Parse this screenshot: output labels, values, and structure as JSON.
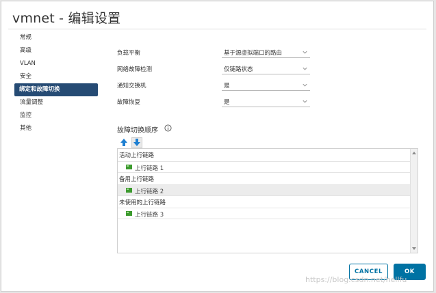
{
  "dialog": {
    "title": "vmnet - 编辑设置"
  },
  "sidebar": {
    "items": [
      {
        "label": "常规"
      },
      {
        "label": "高级"
      },
      {
        "label": "VLAN"
      },
      {
        "label": "安全"
      },
      {
        "label": "绑定和故障切换",
        "active": true
      },
      {
        "label": "流量调整"
      },
      {
        "label": "监控"
      },
      {
        "label": "其他"
      }
    ]
  },
  "settings": {
    "load_balancing": {
      "label": "负载平衡",
      "value": "基于源虚拟端口的路由"
    },
    "network_failure_detection": {
      "label": "网络故障检测",
      "value": "仅链路状态"
    },
    "notify_switches": {
      "label": "通知交换机",
      "value": "是"
    },
    "failback": {
      "label": "故障恢复",
      "value": "是"
    }
  },
  "failover_order": {
    "title": "故障切换顺序",
    "groups": {
      "active": {
        "header": "活动上行链路",
        "uplinks": [
          "上行链路 1"
        ]
      },
      "standby": {
        "header": "备用上行链路",
        "uplinks": [
          "上行链路 2"
        ]
      },
      "unused": {
        "header": "未使用的上行链路",
        "uplinks": [
          "上行链路 3"
        ]
      }
    }
  },
  "buttons": {
    "cancel": "CANCEL",
    "ok": "OK"
  },
  "watermark": "https://blog.csdn.net/hellfu",
  "colors": {
    "accent": "#0072a3",
    "nav_active_bg": "#264b74",
    "uplink_icon": "#3c9a2e"
  }
}
